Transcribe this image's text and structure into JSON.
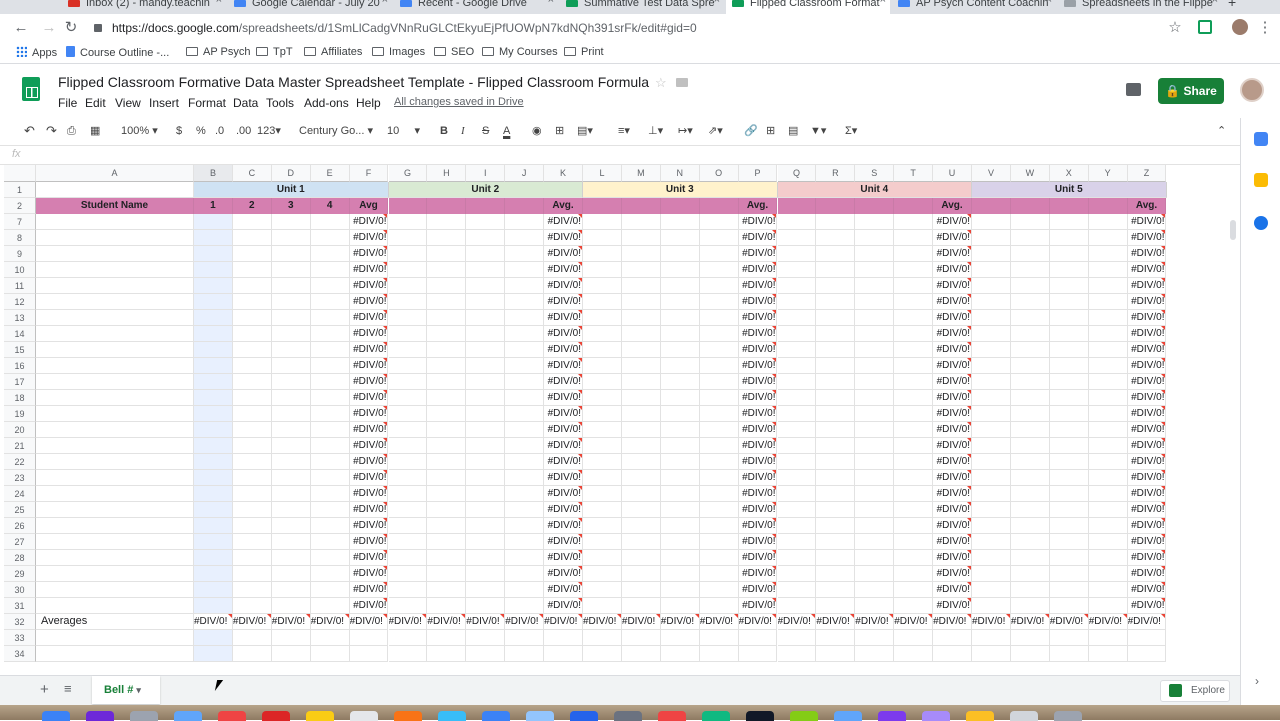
{
  "browser": {
    "tabs": [
      {
        "label": "Inbox (2) - mandy.teachin",
        "color": "#d93025"
      },
      {
        "label": "Google Calendar - July 20",
        "color": "#4285f4"
      },
      {
        "label": "Recent - Google Drive",
        "color": "#4285f4"
      },
      {
        "label": "Summative Test Data Spre",
        "color": "#0f9d58"
      },
      {
        "label": "Flipped Classroom Format",
        "color": "#0f9d58"
      },
      {
        "label": "AP Psych Content Coachin",
        "color": "#4285f4"
      },
      {
        "label": "Spreadsheets in the Flippe",
        "color": "#9aa0a6"
      }
    ],
    "url_prefix": "https://docs.google.com",
    "url_path": "/spreadsheets/d/1SmLlCadgVNnRuGLCtEkyuEjPfUOWpN7kdNQh391srFk/edit#gid=0",
    "bookmarks": [
      "Apps",
      "Course Outline -...",
      "AP Psych",
      "TpT",
      "Affiliates",
      "Images",
      "SEO",
      "My Courses",
      "Print"
    ]
  },
  "doc": {
    "title": "Flipped Classroom Formative Data Master Spreadsheet Template - Flipped Classroom Formula",
    "menus": [
      "File",
      "Edit",
      "View",
      "Insert",
      "Format",
      "Data",
      "Tools",
      "Add-ons",
      "Help"
    ],
    "saved_status": "All changes saved in Drive",
    "share_label": "Share"
  },
  "toolbar": {
    "zoom": "100%",
    "currency": "$",
    "percent": "%",
    "decimal_less": ".0",
    "decimal_more": ".00",
    "number_format": "123",
    "font": "Century Go...",
    "font_size": "10"
  },
  "formula_bar": {
    "fx": "fx"
  },
  "sheet": {
    "column_letters": [
      "A",
      "B",
      "C",
      "D",
      "E",
      "F",
      "G",
      "H",
      "I",
      "J",
      "K",
      "L",
      "M",
      "N",
      "O",
      "P",
      "Q",
      "R",
      "S",
      "T",
      "U",
      "V",
      "W",
      "X",
      "Y",
      "Z"
    ],
    "units": [
      {
        "label": "Unit 1",
        "color": "#cfe2f3"
      },
      {
        "label": "Unit 2",
        "color": "#d9ead3"
      },
      {
        "label": "Unit 3",
        "color": "#fff2cc"
      },
      {
        "label": "Unit 4",
        "color": "#f4cccc"
      },
      {
        "label": "Unit 5",
        "color": "#d9d2e9"
      }
    ],
    "header_row": {
      "student_name": "Student Name",
      "unit1_cols": [
        "1",
        "2",
        "3",
        "4",
        "Avg"
      ],
      "avg_label": "Avg."
    },
    "visible_rows": [
      "1",
      "2",
      "7",
      "8",
      "9",
      "10",
      "11",
      "12",
      "13",
      "14",
      "15",
      "16",
      "17",
      "18",
      "19",
      "20",
      "21",
      "22",
      "23",
      "24",
      "25",
      "26",
      "27",
      "28",
      "29",
      "30",
      "31",
      "32",
      "33",
      "34"
    ],
    "error_value": "#DIV/0!",
    "averages_label": "Averages",
    "header_color": "#d57fb0"
  },
  "sheet_tabs": {
    "active": "Bell #",
    "explore": "Explore"
  }
}
